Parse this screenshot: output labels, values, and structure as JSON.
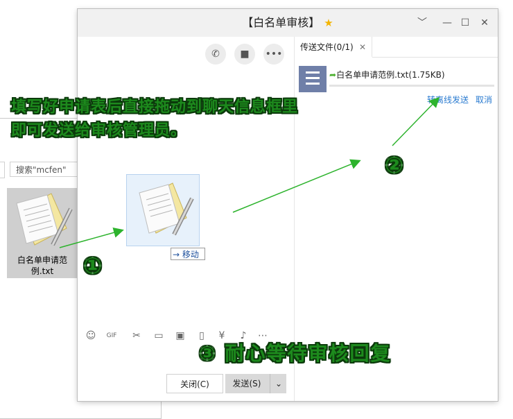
{
  "explorer": {
    "search_placeholder": "搜索\"mcfen\"",
    "file_name_line1": "白名单申请范",
    "file_name_line2": "例.txt"
  },
  "chat_window": {
    "title": "【白名单审核】",
    "title_icon": "star-icon",
    "window_controls": [
      "chevron-down-icon",
      "minimize-icon",
      "maximize-icon",
      "close-icon"
    ],
    "call_buttons": [
      "phone-icon",
      "video-icon",
      "more-icon"
    ],
    "toolbar_icons": [
      "emoji-icon",
      "gif-icon",
      "scissors-icon",
      "folder-icon",
      "image-icon",
      "shake-icon",
      "red-packet-icon",
      "music-icon",
      "more-icon"
    ],
    "close_button": "关闭(C)",
    "send_button": "发送(S)"
  },
  "side_panel": {
    "tab_label": "传送文件(0/1)",
    "transfer_file": "白名单申请范例.txt(1.75KB)",
    "progress": 0,
    "offline_send_link": "转离线发送",
    "cancel_link": "取消"
  },
  "drag": {
    "tooltip": "→ 移动"
  },
  "annotations": {
    "step1_line1": "填写好申请表后直接拖动到聊天信息框里",
    "step1_line2": "即可发送给审核管理员。",
    "badge1": "①",
    "badge2": "②",
    "step3": "③ 耐心等待审核回复",
    "color": "#1d8a1d"
  }
}
